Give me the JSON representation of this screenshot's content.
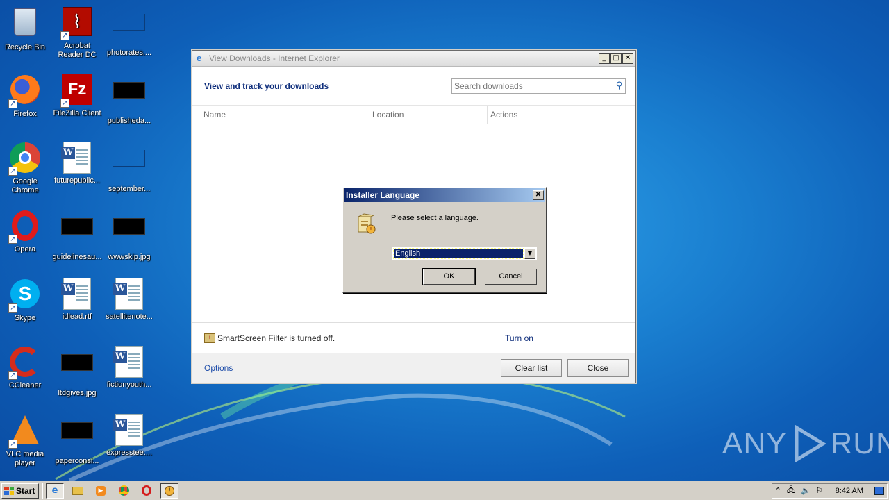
{
  "desktop": {
    "icons": [
      {
        "label": "Recycle Bin",
        "icon": "recycle-bin-icon"
      },
      {
        "label": "Acrobat Reader DC",
        "icon": "acrobat-icon"
      },
      {
        "label": "photorates....",
        "icon": "image-file-icon"
      },
      {
        "label": "Firefox",
        "icon": "firefox-icon"
      },
      {
        "label": "FileZilla Client",
        "icon": "filezilla-icon"
      },
      {
        "label": "publisheda...",
        "icon": "image-file-icon"
      },
      {
        "label": "Google Chrome",
        "icon": "chrome-icon"
      },
      {
        "label": "futurepublic...",
        "icon": "word-doc-icon"
      },
      {
        "label": "september...",
        "icon": "image-file-icon"
      },
      {
        "label": "Opera",
        "icon": "opera-icon"
      },
      {
        "label": "guidelinesau...",
        "icon": "image-file-icon"
      },
      {
        "label": "wwwskip.jpg",
        "icon": "image-file-icon"
      },
      {
        "label": "Skype",
        "icon": "skype-icon"
      },
      {
        "label": "idlead.rtf",
        "icon": "word-doc-icon"
      },
      {
        "label": "satellitenote...",
        "icon": "word-doc-icon"
      },
      {
        "label": "CCleaner",
        "icon": "ccleaner-icon"
      },
      {
        "label": "ltdgives.jpg",
        "icon": "image-file-icon"
      },
      {
        "label": "fictionyouth...",
        "icon": "word-doc-icon"
      },
      {
        "label": "VLC media player",
        "icon": "vlc-icon"
      },
      {
        "label": "paperconsi...",
        "icon": "image-file-icon"
      },
      {
        "label": "expresstee....",
        "icon": "word-doc-icon"
      }
    ]
  },
  "ie_window": {
    "title": "View Downloads - Internet Explorer",
    "heading": "View and track your downloads",
    "search_placeholder": "Search downloads",
    "columns": [
      "Name",
      "Location",
      "Actions"
    ],
    "smartscreen_text": "SmartScreen Filter is turned off.",
    "turn_on_label": "Turn on",
    "options_label": "Options",
    "clear_list_label": "Clear list",
    "close_label": "Close"
  },
  "installer_dialog": {
    "title": "Installer Language",
    "prompt": "Please select a language.",
    "selected_language": "English",
    "ok_label": "OK",
    "cancel_label": "Cancel"
  },
  "taskbar": {
    "start_label": "Start",
    "clock": "8:42 AM"
  },
  "watermark": {
    "left": "ANY",
    "right": "RUN"
  }
}
